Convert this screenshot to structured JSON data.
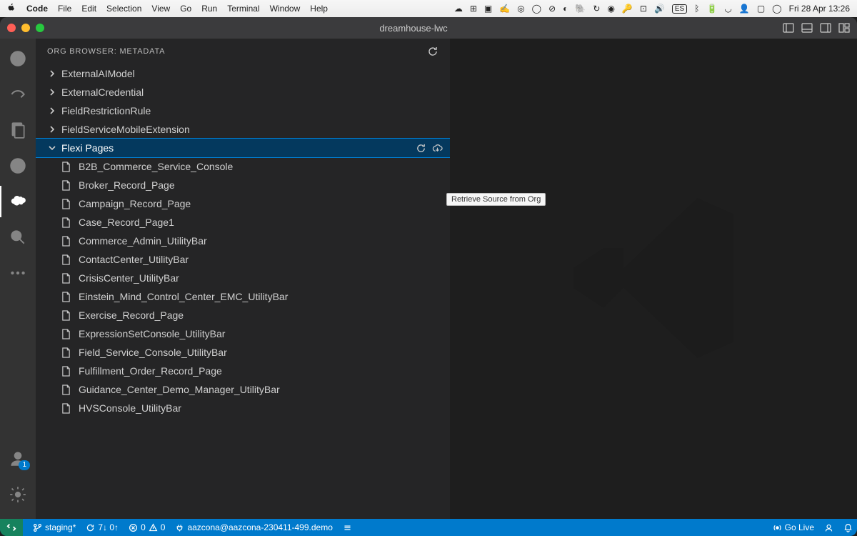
{
  "menubar": {
    "app": "Code",
    "items": [
      "File",
      "Edit",
      "Selection",
      "View",
      "Go",
      "Run",
      "Terminal",
      "Window",
      "Help"
    ],
    "lang_indicator": "ES",
    "datetime": "Fri 28 Apr  13:26"
  },
  "window": {
    "title": "dreamhouse-lwc"
  },
  "sidebar": {
    "title": "ORG BROWSER: METADATA"
  },
  "tree": {
    "folders_collapsed": [
      "ExternalAIModel",
      "ExternalCredential",
      "FieldRestrictionRule",
      "FieldServiceMobileExtension"
    ],
    "selected_folder": "Flexi Pages",
    "files": [
      "B2B_Commerce_Service_Console",
      "Broker_Record_Page",
      "Campaign_Record_Page",
      "Case_Record_Page1",
      "Commerce_Admin_UtilityBar",
      "ContactCenter_UtilityBar",
      "CrisisCenter_UtilityBar",
      "Einstein_Mind_Control_Center_EMC_UtilityBar",
      "Exercise_Record_Page",
      "ExpressionSetConsole_UtilityBar",
      "Field_Service_Console_UtilityBar",
      "Fulfillment_Order_Record_Page",
      "Guidance_Center_Demo_Manager_UtilityBar",
      "HVSConsole_UtilityBar"
    ]
  },
  "tooltip": "Retrieve Source from Org",
  "activity_badge": "1",
  "statusbar": {
    "branch": "staging*",
    "sync": "7↓ 0↑",
    "errors": "0",
    "warnings": "0",
    "org": "aazcona@aazcona-230411-499.demo",
    "golive": "Go Live"
  }
}
